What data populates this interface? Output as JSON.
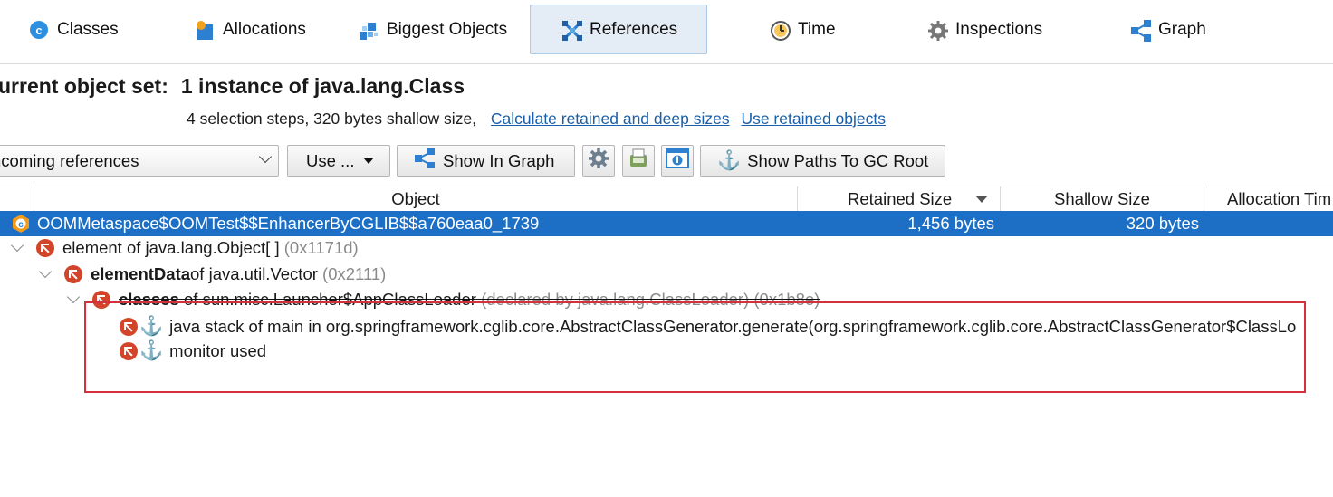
{
  "tabs": [
    {
      "label": "Classes",
      "icon": "classes-icon"
    },
    {
      "label": "Allocations",
      "icon": "allocations-icon"
    },
    {
      "label": "Biggest Objects",
      "icon": "biggest-objects-icon"
    },
    {
      "label": "References",
      "icon": "references-icon",
      "active": true
    },
    {
      "label": "Time",
      "icon": "time-icon"
    },
    {
      "label": "Inspections",
      "icon": "inspections-icon"
    },
    {
      "label": "Graph",
      "icon": "graph-icon"
    }
  ],
  "header": {
    "title_prefix": "urrent object set:",
    "title_value": "1 instance of java.lang.Class",
    "summary": "4 selection steps, 320 bytes shallow size,",
    "link_calc": "Calculate retained and deep sizes",
    "link_use": "Use retained objects"
  },
  "toolbar": {
    "view_select": "ncoming references",
    "use_label": "Use ...",
    "show_graph_label": "Show In Graph",
    "gc_root_label": "Show Paths To GC Root"
  },
  "table": {
    "columns": [
      "Object",
      "Retained Size",
      "Shallow Size",
      "Allocation Tim"
    ],
    "selected_row": {
      "object": "OOMMetaspace$OOMTest$$EnhancerByCGLIB$$a760eaa0_1739",
      "retained": "1,456 bytes",
      "shallow": "320 bytes"
    },
    "tree": [
      {
        "prefix": "element of java.lang.Object[ ]",
        "bold": "",
        "suffix": "",
        "id": "(0x1171d)"
      },
      {
        "prefix": "",
        "bold": "elementData",
        "suffix": " of java.util.Vector",
        "id": "(0x2111)"
      },
      {
        "prefix": "",
        "bold": "classes",
        "suffix": " of sun.misc.Launcher$AppClassLoader",
        "id": "(declared by java.lang.ClassLoader) (0x1b8e)"
      },
      {
        "text": "java stack of main in org.springframework.cglib.core.AbstractClassGenerator.generate(org.springframework.cglib.core.AbstractClassGenerator$ClassLo"
      },
      {
        "text": "monitor used"
      }
    ]
  },
  "colors": {
    "selection": "#1c6fc5",
    "link": "#1a5fa8",
    "annotation_box": "#d6303c",
    "gc_icon": "#d2452a"
  }
}
